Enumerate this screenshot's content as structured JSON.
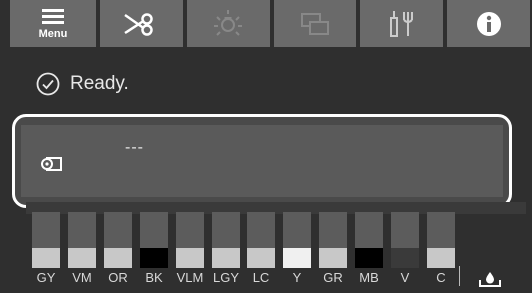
{
  "toolbar": {
    "menu_label": "Menu",
    "buttons": [
      {
        "icon": "menu-icon"
      },
      {
        "icon": "scissors-icon"
      },
      {
        "icon": "light-icon"
      },
      {
        "icon": "layout-icon"
      },
      {
        "icon": "maintenance-tools-icon"
      },
      {
        "icon": "info-icon"
      }
    ]
  },
  "status": {
    "text": "Ready.",
    "icon": "check-circle-icon"
  },
  "paper": {
    "icon": "paper-roll-icon",
    "text": "---"
  },
  "inks": [
    {
      "label": "GY",
      "level": 0.0
    },
    {
      "label": "VM",
      "level": 0.0
    },
    {
      "label": "OR",
      "level": 0.0
    },
    {
      "label": "BK",
      "level": 0.0
    },
    {
      "label": "VLM",
      "level": 0.0
    },
    {
      "label": "LGY",
      "level": 0.0
    },
    {
      "label": "LC",
      "level": 0.0
    },
    {
      "label": "Y",
      "level": 0.0
    },
    {
      "label": "GR",
      "level": 0.0
    },
    {
      "label": "MB",
      "level": 0.0
    },
    {
      "label": "V",
      "level": 0.0
    },
    {
      "label": "C",
      "level": 0.0
    }
  ],
  "maintenance": {
    "icon": "maintenance-box-icon"
  },
  "colors": {
    "ink_fill": [
      "#c8c8c8",
      "#c8c8c8",
      "#c8c8c8",
      "#000000",
      "#c8c8c8",
      "#c8c8c8",
      "#c8c8c8",
      "#f0f0f0",
      "#c8c8c8",
      "#000000",
      "#3a3a3a",
      "#c8c8c8"
    ]
  }
}
